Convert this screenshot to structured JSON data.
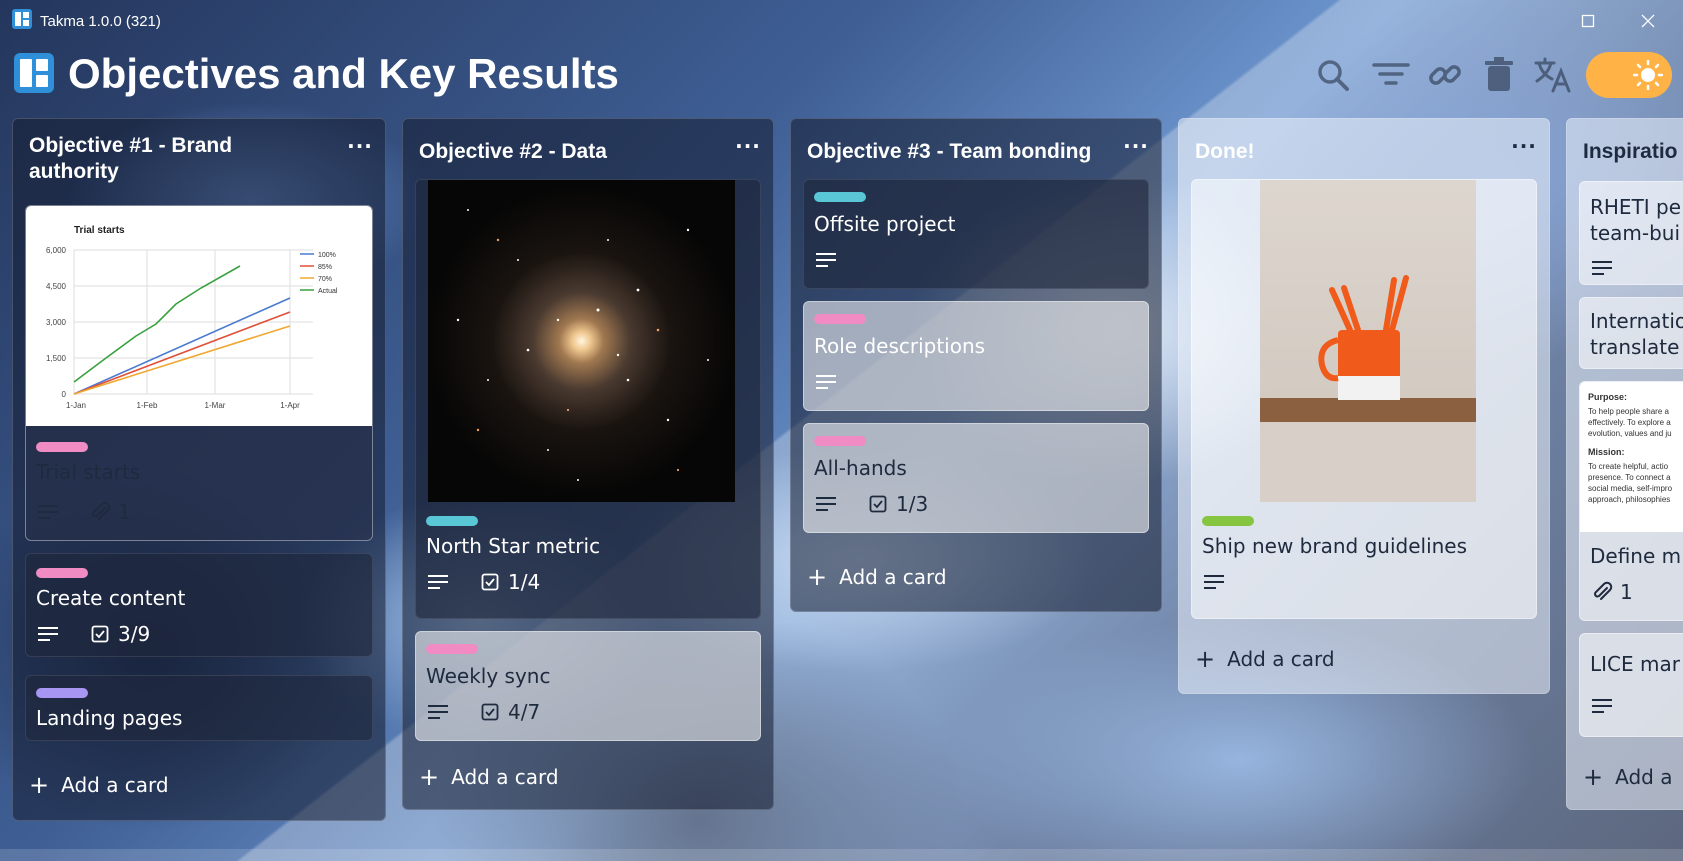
{
  "window": {
    "app_title": "Takma 1.0.0 (321)",
    "maximize_label": "",
    "close_label": ""
  },
  "board": {
    "title": "Objectives and Key Results"
  },
  "toolbar": {
    "icons": [
      "search-icon",
      "filter-icon",
      "link-icon",
      "trash-icon",
      "translate-icon",
      "sun-icon"
    ],
    "theme_toggle_color": "#ffb347"
  },
  "colors": {
    "label_pink": "#f08bc4",
    "label_teal": "#59c7d6",
    "label_purple": "#a897f2",
    "label_green": "#86c540"
  },
  "columns": [
    {
      "title_line1": "Objective #1 - Brand",
      "title_line2": "authority",
      "menu": "···",
      "add_card": "Add a card",
      "cards": [
        {
          "cover_chart": {
            "title": "Trial starts",
            "legend": [
              "100%",
              "85%",
              "70%",
              "Actual"
            ],
            "y_ticks": [
              "6,000",
              "4,500",
              "3,000",
              "1,500",
              "0"
            ],
            "x_ticks": [
              "1-Jan",
              "1-Feb",
              "1-Mar",
              "1-Apr"
            ]
          },
          "label_color": "pink",
          "title": "Trial starts",
          "attachments": "1"
        },
        {
          "label_color": "pink",
          "title": "Create content",
          "checklist": "3/9"
        },
        {
          "label_color": "purple",
          "title": "Landing pages"
        }
      ]
    },
    {
      "title": "Objective #2 - Data",
      "menu": "···",
      "add_card": "Add a card",
      "cards": [
        {
          "cover": "star-cluster-image",
          "label_color": "teal",
          "title": "North Star metric",
          "checklist": "1/4"
        },
        {
          "label_color": "pink",
          "title": "Weekly sync",
          "checklist": "4/7"
        }
      ]
    },
    {
      "title": "Objective #3 - Team bonding",
      "menu": "···",
      "add_card": "Add a card",
      "cards": [
        {
          "label_color": "teal",
          "title": "Offsite project"
        },
        {
          "label_color": "pink",
          "title": "Role descriptions"
        },
        {
          "label_color": "pink",
          "title": "All-hands",
          "checklist": "1/3"
        }
      ]
    },
    {
      "title": "Done!",
      "menu": "···",
      "add_card": "Add a card",
      "cards": [
        {
          "cover": "orange-mug-image",
          "label_color": "green",
          "title": "Ship new brand guidelines"
        }
      ]
    },
    {
      "title": "Inspiratio",
      "add_card": "Add a",
      "cards": [
        {
          "title_line1": "RHETI pe",
          "title_line2": "team-bui"
        },
        {
          "title_line1": "Internatio",
          "title_line2": "translate"
        },
        {
          "doc": {
            "h1": "Purpose:",
            "p1": [
              "To help people share a",
              "effectively. To explore a",
              "evolution, values and ju"
            ],
            "h2": "Mission:",
            "p2": [
              "To create helpful, actio",
              "presence. To connect a",
              "social media, self-impro",
              "approach, philosophies"
            ]
          },
          "title": "Define m",
          "attachments": "1"
        },
        {
          "title": "LICE mar"
        }
      ]
    }
  ]
}
